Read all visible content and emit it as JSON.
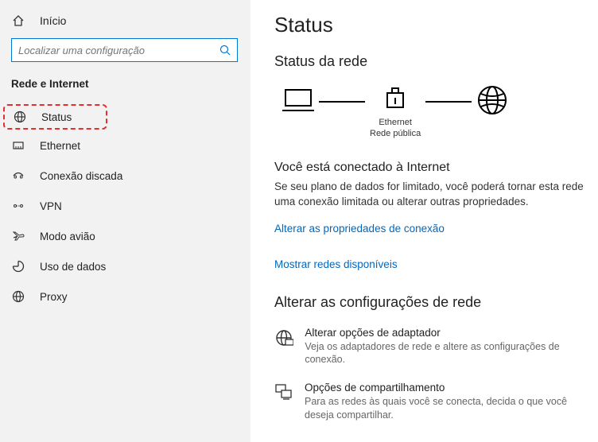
{
  "sidebar": {
    "home_label": "Início",
    "search_placeholder": "Localizar uma configuração",
    "category_label": "Rede e Internet",
    "items": [
      {
        "label": "Status"
      },
      {
        "label": "Ethernet"
      },
      {
        "label": "Conexão discada"
      },
      {
        "label": "VPN"
      },
      {
        "label": "Modo avião"
      },
      {
        "label": "Uso de dados"
      },
      {
        "label": "Proxy"
      }
    ]
  },
  "main": {
    "page_title": "Status",
    "network_status_title": "Status da rede",
    "diagram": {
      "connection_name": "Ethernet",
      "network_type": "Rede pública"
    },
    "connected_title": "Você está conectado à Internet",
    "connected_desc": "Se seu plano de dados for limitado, você poderá tornar esta rede uma conexão limitada ou alterar outras propriedades.",
    "link1": "Alterar as propriedades de conexão",
    "link2": "Mostrar redes disponíveis",
    "change_settings_title": "Alterar as configurações de rede",
    "options": [
      {
        "title": "Alterar opções de adaptador",
        "desc": "Veja os adaptadores de rede e altere as configurações de conexão."
      },
      {
        "title": "Opções de compartilhamento",
        "desc": "Para as redes às quais você se conecta, decida o que você deseja compartilhar."
      }
    ]
  }
}
